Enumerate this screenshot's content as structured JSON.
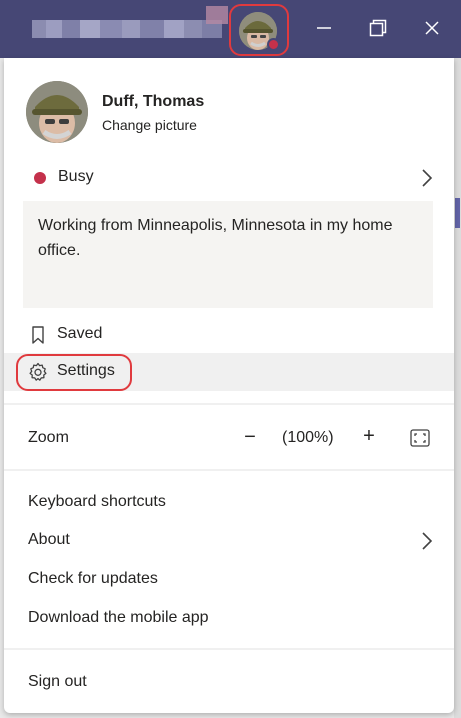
{
  "window": {
    "controls": {
      "minimize_icon": "minimize-icon",
      "restore_icon": "restore-icon",
      "close_icon": "close-icon"
    },
    "titlebar_color": "#464775"
  },
  "profile": {
    "name": "Duff, Thomas",
    "change_picture": "Change picture",
    "presence_color": "#c4314b"
  },
  "status": {
    "label": "Busy",
    "message": "Working from Minneapolis, Minnesota in my home office."
  },
  "menu": {
    "saved": "Saved",
    "settings": "Settings",
    "zoom_label": "Zoom",
    "zoom_minus": "−",
    "zoom_level": "(100%)",
    "zoom_plus": "+",
    "keyboard_shortcuts": "Keyboard shortcuts",
    "about": "About",
    "check_updates": "Check for updates",
    "download_mobile": "Download the mobile app",
    "sign_out": "Sign out"
  },
  "highlight_color": "#e03a3e"
}
